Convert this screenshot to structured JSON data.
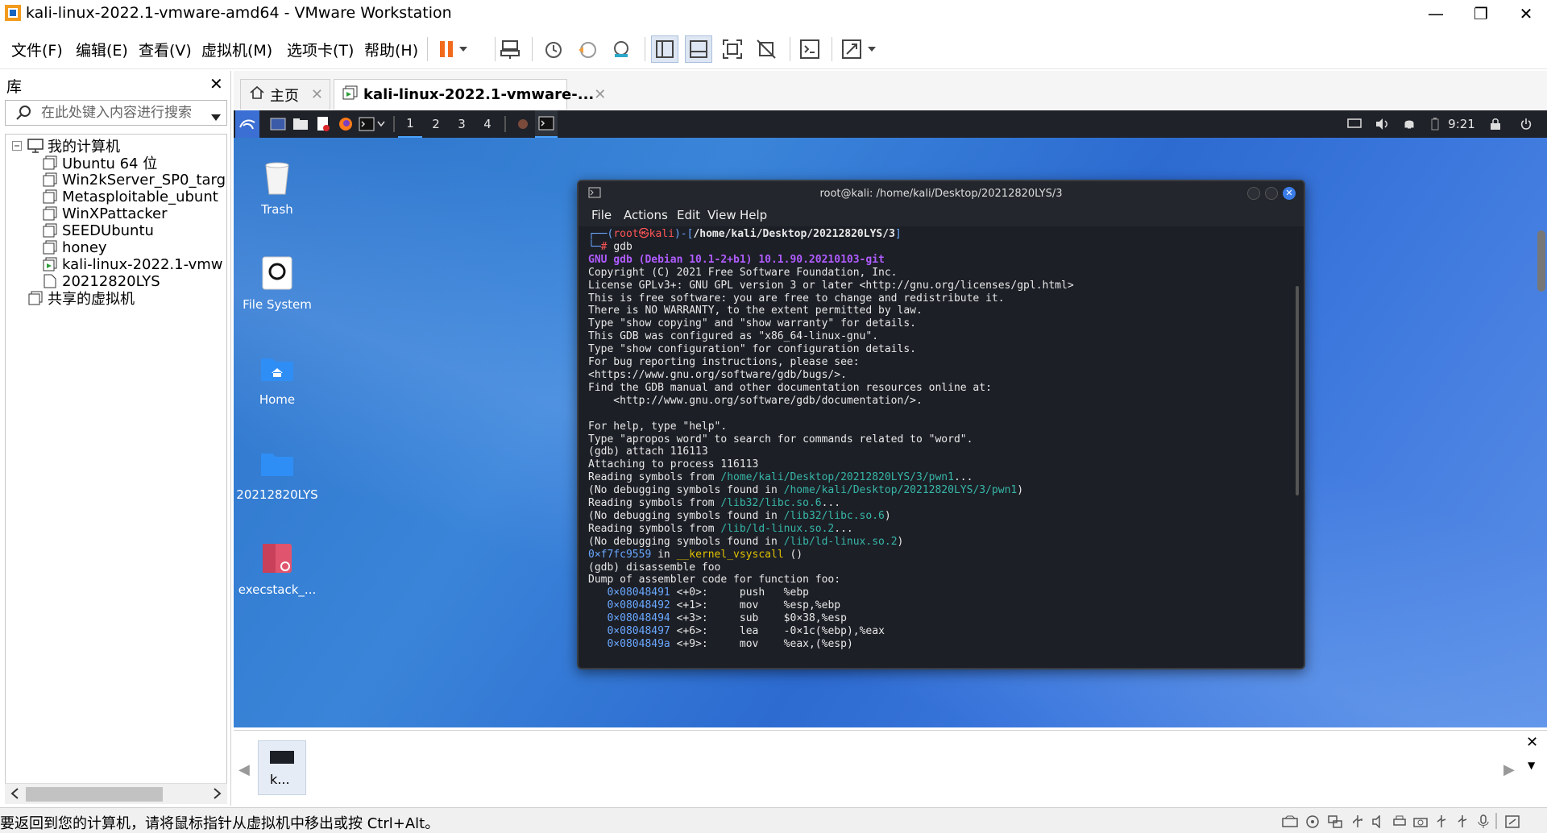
{
  "window": {
    "title": "kali-linux-2022.1-vmware-amd64 - VMware Workstation",
    "minimize": "—",
    "restore": "❐",
    "close": "✕"
  },
  "menu": [
    "文件(F)",
    "编辑(E)",
    "查看(V)",
    "虚拟机(M)",
    "选项卡(T)",
    "帮助(H)"
  ],
  "library": {
    "title": "库",
    "close": "✕",
    "search_placeholder": "在此处键入内容进行搜索",
    "tree": {
      "root": "我的计算机",
      "items": [
        "Ubuntu 64 位",
        "Win2kServer_SP0_targ",
        "Metasploitable_ubunt",
        "WinXPattacker",
        "SEEDUbuntu",
        "honey",
        "kali-linux-2022.1-vmw",
        "20212820LYS"
      ],
      "shared": "共享的虚拟机"
    }
  },
  "tabs": {
    "home": "主页",
    "vm": "kali-linux-2022.1-vmware-..."
  },
  "kali_panel": {
    "workspaces": [
      "1",
      "2",
      "3",
      "4"
    ],
    "clock": "9:21"
  },
  "desktop": {
    "icons": [
      "Trash",
      "File System",
      "Home",
      "20212820LYS",
      "execstack_..."
    ]
  },
  "terminal": {
    "title": "root@kali: /home/kali/Desktop/20212820LYS/3",
    "menu": [
      "File",
      "Actions",
      "Edit",
      "View",
      "Help"
    ],
    "prompt_user": "root",
    "prompt_sep": "㉿",
    "prompt_host": "kali",
    "prompt_path": "/home/kali/Desktop/20212820LYS/3",
    "command": "gdb",
    "gdb_banner": "GNU gdb (Debian 10.1-2+b1) 10.1.90.20210103-git",
    "intro_lines": [
      "Copyright (C) 2021 Free Software Foundation, Inc.",
      "License GPLv3+: GNU GPL version 3 or later <http://gnu.org/licenses/gpl.html>",
      "This is free software: you are free to change and redistribute it.",
      "There is NO WARRANTY, to the extent permitted by law.",
      "Type \"show copying\" and \"show warranty\" for details.",
      "This GDB was configured as \"x86_64-linux-gnu\".",
      "Type \"show configuration\" for configuration details.",
      "For bug reporting instructions, please see:",
      "<https://www.gnu.org/software/gdb/bugs/>.",
      "Find the GDB manual and other documentation resources online at:",
      "    <http://www.gnu.org/software/gdb/documentation/>.",
      "",
      "For help, type \"help\".",
      "Type \"apropos word\" to search for commands related to \"word\".",
      "(gdb) attach 116113",
      "Attaching to process 116113"
    ],
    "reading_pwn1_a": "Reading symbols from ",
    "pwn1_path": "/home/kali/Desktop/20212820LYS/3/pwn1",
    "dots": "...",
    "nodebug_a": "(No debugging symbols found in ",
    "nodebug_b": ")",
    "libc_path": "/lib32/libc.so.6",
    "ld_path": "/lib/ld-linux.so.2",
    "vsys_addr": "0×f7fc9559",
    "vsys_in": " in ",
    "vsys_fn": "__kernel_vsyscall",
    "vsys_tail": " ()",
    "disas_cmd": "(gdb) disassemble foo",
    "dump_hdr": "Dump of assembler code for function foo:",
    "asm": [
      {
        "addr": "0×08048491",
        "off": " <+0>:",
        "op": "push",
        "args": "%ebp"
      },
      {
        "addr": "0×08048492",
        "off": " <+1>:",
        "op": "mov",
        "args": "%esp,%ebp"
      },
      {
        "addr": "0×08048494",
        "off": " <+3>:",
        "op": "sub",
        "args": "$0×38,%esp"
      },
      {
        "addr": "0×08048497",
        "off": " <+6>:",
        "op": "lea",
        "args": "-0×1c(%ebp),%eax"
      },
      {
        "addr": "0×0804849a",
        "off": " <+9>:",
        "op": "mov",
        "args": "%eax,(%esp)"
      }
    ]
  },
  "thumbnail": {
    "label": "k..."
  },
  "status": {
    "message": "要返回到您的计算机，请将鼠标指针从虚拟机中移出或按 Ctrl+Alt。"
  }
}
